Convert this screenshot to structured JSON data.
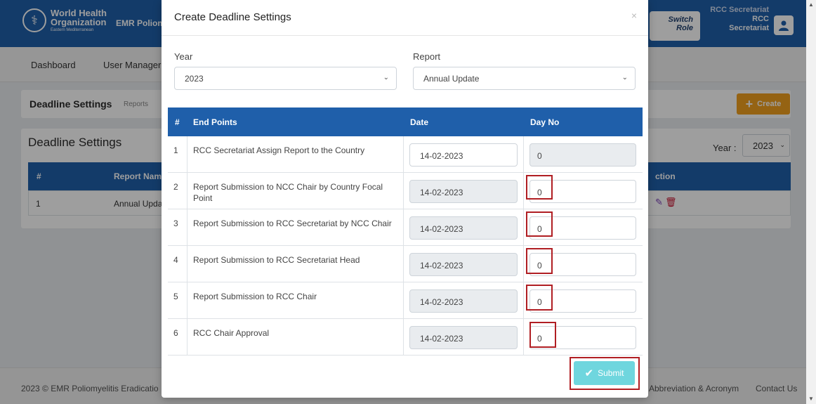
{
  "app": {
    "org_name_line1": "World Health",
    "org_name_line2": "Organization",
    "org_sub": "Eastern Mediterranean",
    "app_name": "EMR Poliomy",
    "switch_role_line1": "Switch",
    "switch_role_line2": "Role",
    "user_role_line1": "RCC Secretariat",
    "user_role_line2": "RCC",
    "user_role_line3": "Secretariat"
  },
  "nav": {
    "items": [
      {
        "label": "Dashboard"
      },
      {
        "label": "User Manager"
      }
    ]
  },
  "breadcrumb": {
    "title": "Deadline Settings",
    "sub": "Reports",
    "create_label": "Create"
  },
  "page": {
    "title": "Deadline Settings",
    "year_label": "Year :",
    "year_value": "2023",
    "table_headers": [
      "#",
      "Report Nam",
      "ction"
    ],
    "row": {
      "num": "1",
      "name": "Annual Upda"
    }
  },
  "footer": {
    "left": "2023 © EMR Poliomyelitis Eradicatio",
    "links": [
      "Abbreviation & Acronym",
      "Contact Us"
    ]
  },
  "modal": {
    "title": "Create Deadline Settings",
    "close": "×",
    "year_label": "Year",
    "year_value": "2023",
    "report_label": "Report",
    "report_value": "Annual Update",
    "headers": {
      "num": "#",
      "end_points": "End Points",
      "date": "Date",
      "day_no": "Day No"
    },
    "rows": [
      {
        "num": "1",
        "end_point": "RCC Secretariat Assign Report to the Country",
        "date": "14-02-2023",
        "day_no": "0"
      },
      {
        "num": "2",
        "end_point": "Report Submission to NCC Chair by Country Focal Point",
        "date": "14-02-2023",
        "day_no": "0"
      },
      {
        "num": "3",
        "end_point": "Report Submission to RCC Secretariat by NCC Chair",
        "date": "14-02-2023",
        "day_no": "0"
      },
      {
        "num": "4",
        "end_point": "Report Submission to RCC Secretariat Head",
        "date": "14-02-2023",
        "day_no": "0"
      },
      {
        "num": "5",
        "end_point": "Report Submission to RCC Chair",
        "date": "14-02-2023",
        "day_no": "0"
      },
      {
        "num": "6",
        "end_point": "RCC Chair Approval",
        "date": "14-02-2023",
        "day_no": "0"
      }
    ],
    "submit_label": "Submit"
  },
  "colors": {
    "primary": "#1f5faa",
    "create": "#f0a020",
    "submit": "#6fd6de",
    "highlight": "#b01e23"
  }
}
